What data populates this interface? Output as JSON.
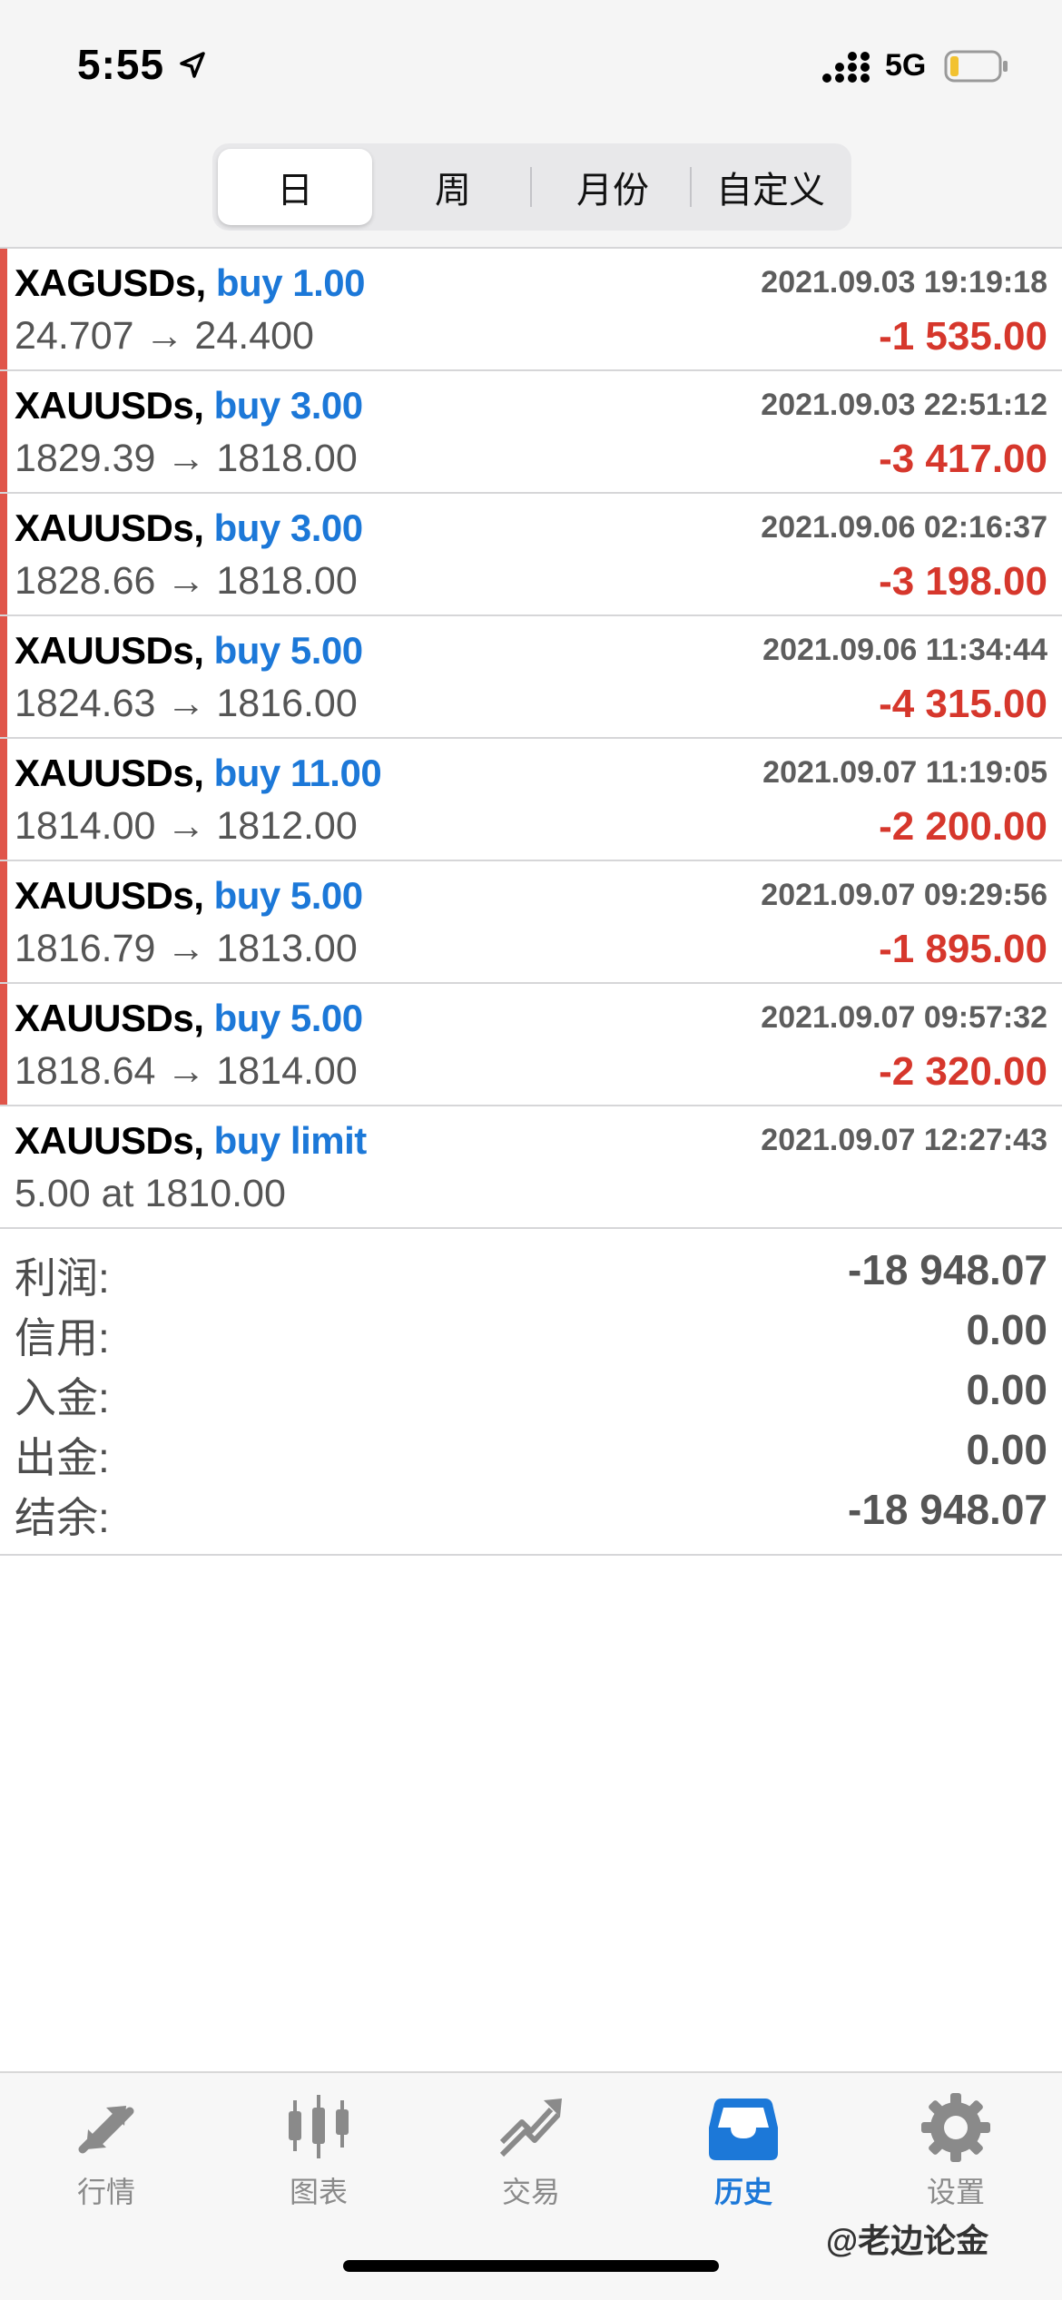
{
  "status_bar": {
    "time": "5:55",
    "network": "5G"
  },
  "period_tabs": [
    {
      "label": "日",
      "active": true
    },
    {
      "label": "周",
      "active": false
    },
    {
      "label": "月份",
      "active": false
    },
    {
      "label": "自定义",
      "active": false
    }
  ],
  "deals": [
    {
      "symbol": "XAGUSDs,",
      "action": "buy 1.00",
      "time": "2021.09.03 19:19:18",
      "prices": "24.707 → 24.400",
      "profit": "-1 535.00"
    },
    {
      "symbol": "XAUUSDs,",
      "action": "buy 3.00",
      "time": "2021.09.03 22:51:12",
      "prices": "1829.39 → 1818.00",
      "profit": "-3 417.00"
    },
    {
      "symbol": "XAUUSDs,",
      "action": "buy 3.00",
      "time": "2021.09.06 02:16:37",
      "prices": "1828.66 → 1818.00",
      "profit": "-3 198.00"
    },
    {
      "symbol": "XAUUSDs,",
      "action": "buy 5.00",
      "time": "2021.09.06 11:34:44",
      "prices": "1824.63 → 1816.00",
      "profit": "-4 315.00"
    },
    {
      "symbol": "XAUUSDs,",
      "action": "buy 11.00",
      "time": "2021.09.07 11:19:05",
      "prices": "1814.00 → 1812.00",
      "profit": "-2 200.00"
    },
    {
      "symbol": "XAUUSDs,",
      "action": "buy 5.00",
      "time": "2021.09.07 09:29:56",
      "prices": "1816.79 → 1813.00",
      "profit": "-1 895.00"
    },
    {
      "symbol": "XAUUSDs,",
      "action": "buy 5.00",
      "time": "2021.09.07 09:57:32",
      "prices": "1818.64 → 1814.00",
      "profit": "-2 320.00"
    }
  ],
  "pending_order": {
    "symbol": "XAUUSDs,",
    "action": "buy limit",
    "time": "2021.09.07 12:27:43",
    "details": "5.00 at 1810.00"
  },
  "summary": [
    {
      "label": "利润:",
      "value": "-18 948.07"
    },
    {
      "label": "信用:",
      "value": "0.00"
    },
    {
      "label": "入金:",
      "value": "0.00"
    },
    {
      "label": "出金:",
      "value": "0.00"
    },
    {
      "label": "结余:",
      "value": "-18 948.07"
    }
  ],
  "tab_bar": [
    {
      "label": "行情",
      "icon": "quotes-arrows-icon",
      "active": false
    },
    {
      "label": "图表",
      "icon": "candlestick-chart-icon",
      "active": false
    },
    {
      "label": "交易",
      "icon": "trade-line-icon",
      "active": false
    },
    {
      "label": "历史",
      "icon": "history-inbox-icon",
      "active": true
    },
    {
      "label": "设置",
      "icon": "settings-gear-icon",
      "active": false
    }
  ],
  "watermark": "@老边论金",
  "colors": {
    "accent": "#1c78d8",
    "loss": "#d6372c",
    "loss_bar": "#e0554a"
  }
}
